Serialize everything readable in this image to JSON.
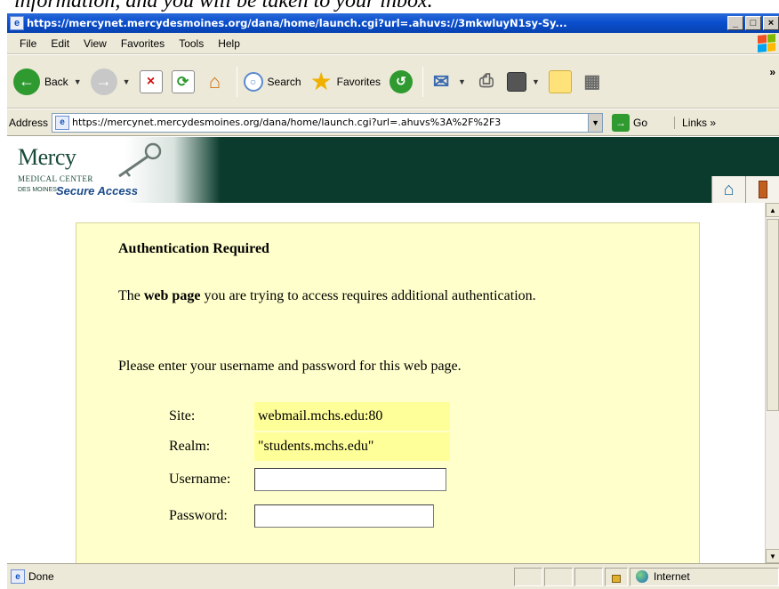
{
  "doc_caption": "information, and you will be taken to your inbox.",
  "window": {
    "title": "https://mercynet.mercydesmoines.org/dana/home/launch.cgi?url=.ahuvs://3mkwluyN1sy-Sy..."
  },
  "menubar": {
    "items": [
      "File",
      "Edit",
      "View",
      "Favorites",
      "Tools",
      "Help"
    ]
  },
  "toolbar": {
    "back_label": "Back",
    "search_label": "Search",
    "favorites_label": "Favorites",
    "overflow": "»"
  },
  "addressbar": {
    "label": "Address",
    "url": "https://mercynet.mercydesmoines.org/dana/home/launch.cgi?url=.ahuvs%3A%2F%2F3",
    "go_label": "Go",
    "links_label": "Links »"
  },
  "banner": {
    "logo_name": "Mercy",
    "logo_medical": "MEDICAL CENTER",
    "logo_location": "DES MOINES",
    "logo_secure": "Secure Access"
  },
  "auth": {
    "title": "Authentication Required",
    "msg_prefix": "The ",
    "msg_bold": "web page",
    "msg_suffix": " you are trying to access requires additional authentication.",
    "prompt": "Please enter your username and password for this web page.",
    "site_label": "Site:",
    "site_value": "webmail.mchs.edu:80",
    "realm_label": "Realm:",
    "realm_value": "\"students.mchs.edu\"",
    "username_label": "Username:",
    "username_value": "",
    "password_label": "Password:",
    "password_value": ""
  },
  "statusbar": {
    "text": "Done",
    "zone": "Internet"
  }
}
